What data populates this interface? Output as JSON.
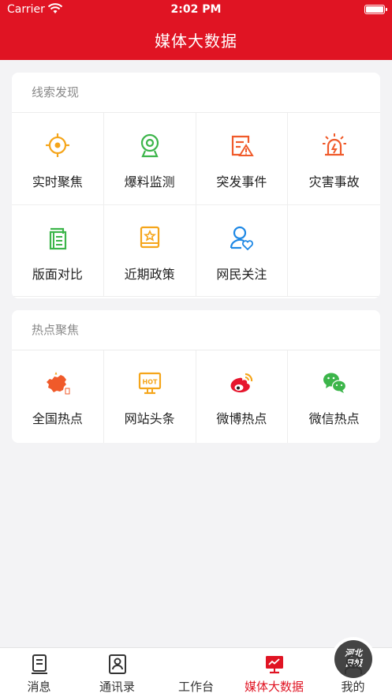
{
  "status": {
    "carrier": "Carrier",
    "time": "2:02 PM"
  },
  "header": {
    "title": "媒体大数据"
  },
  "clues": {
    "title": "线索发现",
    "items": [
      {
        "label": "实时聚焦",
        "icon": "crosshair-icon",
        "color": "#f5a51a"
      },
      {
        "label": "爆料监测",
        "icon": "webcam-icon",
        "color": "#3cb54a"
      },
      {
        "label": "突发事件",
        "icon": "alert-document-icon",
        "color": "#f05a2a"
      },
      {
        "label": "灾害事故",
        "icon": "siren-icon",
        "color": "#f05a2a"
      },
      {
        "label": "版面对比",
        "icon": "newspaper-icon",
        "color": "#3cb54a"
      },
      {
        "label": "近期政策",
        "icon": "policy-book-icon",
        "color": "#f5a51a"
      },
      {
        "label": "网民关注",
        "icon": "user-heart-icon",
        "color": "#1e88e5"
      }
    ]
  },
  "hotspots": {
    "title": "热点聚焦",
    "items": [
      {
        "label": "全国热点",
        "icon": "china-map-icon",
        "color": "#f05a2a"
      },
      {
        "label": "网站头条",
        "icon": "hot-monitor-icon",
        "color": "#f5a51a"
      },
      {
        "label": "微博热点",
        "icon": "weibo-icon",
        "color": "#e6162d"
      },
      {
        "label": "微信热点",
        "icon": "wechat-icon",
        "color": "#3cb54a"
      }
    ]
  },
  "tabbar": {
    "items": [
      {
        "label": "消息",
        "icon": "message-icon"
      },
      {
        "label": "通讯录",
        "icon": "contacts-icon"
      },
      {
        "label": "工作台",
        "icon": "workbench-logo-icon",
        "logo_text": "河北日报"
      },
      {
        "label": "媒体大数据",
        "icon": "bigdata-monitor-icon",
        "active": true
      },
      {
        "label": "我的",
        "icon": "profile-icon"
      }
    ],
    "active_color": "#e01423"
  }
}
